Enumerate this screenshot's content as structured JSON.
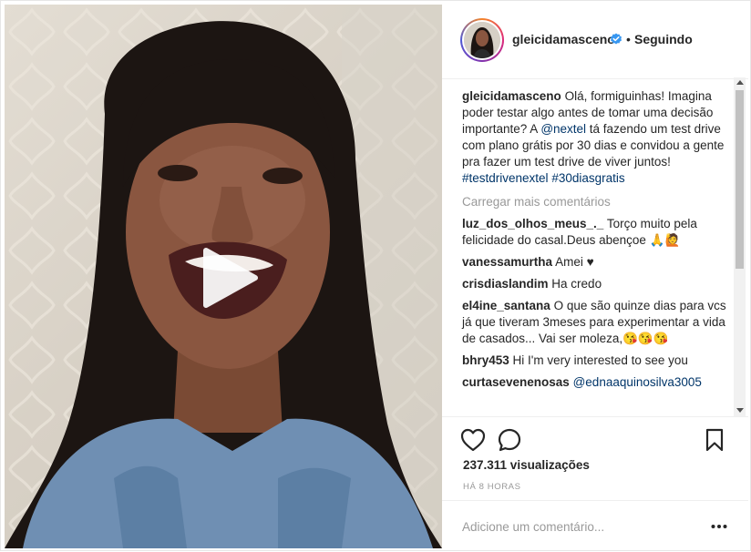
{
  "post": {
    "username": "gleicidamasceno",
    "separator": "•",
    "follow_status": "Seguindo"
  },
  "caption": {
    "username": "gleicidamasceno",
    "text_1": " Olá, formiguinhas! Imagina poder testar algo antes de tomar uma decisão importante? A ",
    "mention": "@nextel",
    "text_2": " tá fazendo um test drive com plano grátis por 30 dias e convidou a gente pra fazer um test drive de viver juntos!",
    "hashtag_1": "#testdrivenextel",
    "hashtag_2": "#30diasgratis"
  },
  "load_more": "Carregar mais comentários",
  "comments": [
    {
      "user": "luz_dos_olhos_meus_._",
      "text": " Torço muito pela felicidade do casal.Deus abençoe 🙏🙋"
    },
    {
      "user": "vanessamurtha",
      "text": " Amei ♥"
    },
    {
      "user": "crisdiaslandim",
      "text": " Ha credo"
    },
    {
      "user": "el4ine_santana",
      "text": " O que são quinze dias para vcs já que tiveram 3meses para experimentar a vida de casados... Vai ser moleza,😘😘😘"
    },
    {
      "user": "bhry453",
      "text": " Hi I'm very interested to see you"
    },
    {
      "user": "curtasevenenosas",
      "mention": "@ednaaquinosilva3005"
    }
  ],
  "stats": {
    "views": "237.311 visualizações",
    "time_ago": "HÁ 8 HORAS"
  },
  "add_comment": {
    "placeholder": "Adicione um comentário..."
  },
  "icons": {
    "verified": "verified-badge-icon",
    "like": "heart-icon",
    "comment": "comment-bubble-icon",
    "save": "bookmark-icon",
    "more": "ellipsis-icon",
    "play": "play-icon"
  },
  "colors": {
    "link": "#003569",
    "verified": "#3897f0",
    "muted": "#999999",
    "text": "#262626"
  }
}
